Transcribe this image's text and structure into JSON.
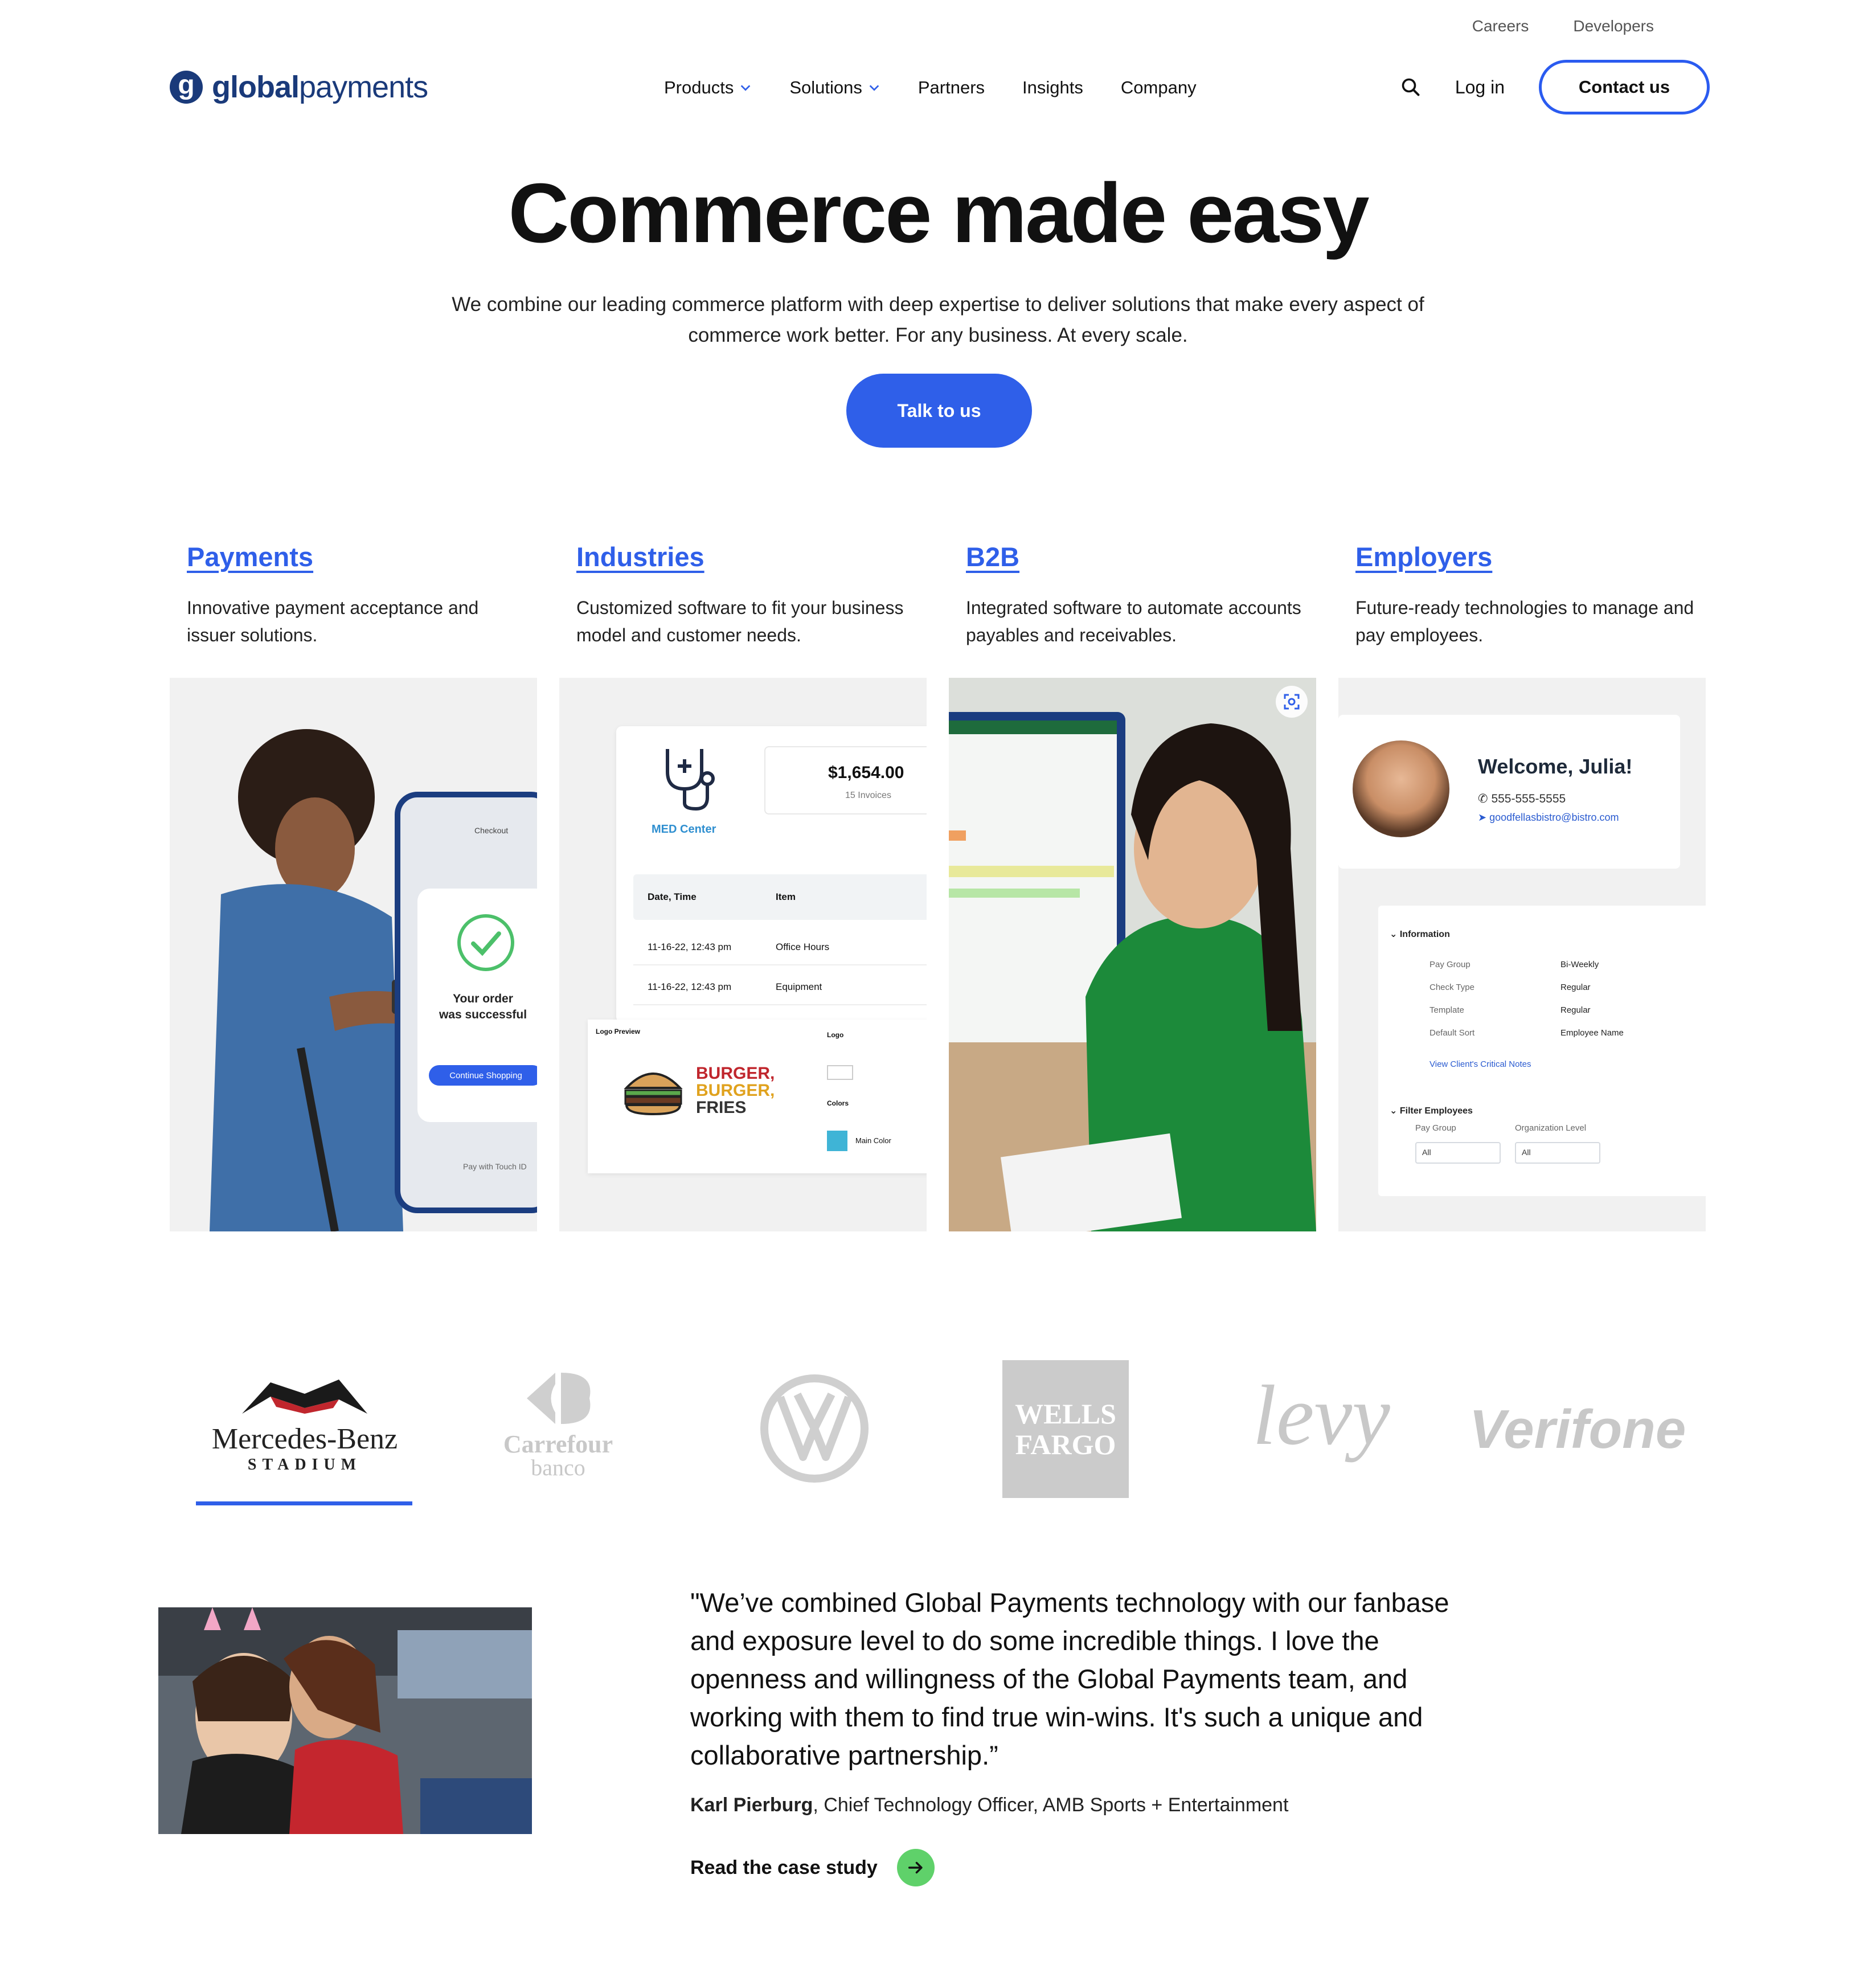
{
  "utility_nav": {
    "careers": "Careers",
    "developers": "Developers"
  },
  "brand": {
    "logo_bold": "global",
    "logo_light": "payments",
    "mark": "g"
  },
  "nav": {
    "items": [
      {
        "label": "Products",
        "has_dropdown": true
      },
      {
        "label": "Solutions",
        "has_dropdown": true
      },
      {
        "label": "Partners",
        "has_dropdown": false
      },
      {
        "label": "Insights",
        "has_dropdown": false
      },
      {
        "label": "Company",
        "has_dropdown": false
      }
    ],
    "login": "Log in",
    "contact": "Contact us"
  },
  "hero": {
    "title": "Commerce made easy",
    "subtitle": "We combine our leading commerce platform with deep expertise to deliver solutions that make every aspect of commerce work better. For any business. At every scale.",
    "cta": "Talk to us"
  },
  "categories": [
    {
      "title": "Payments",
      "desc": "Innovative payment acceptance and issuer solutions."
    },
    {
      "title": "Industries",
      "desc": "Customized software to fit your business model and customer needs."
    },
    {
      "title": "B2B",
      "desc": "Integrated software to automate accounts payables and receivables."
    },
    {
      "title": "Employers",
      "desc": "Future-ready technologies to manage and pay employees."
    }
  ],
  "payments_panel": {
    "order_msg_1": "Your order",
    "order_msg_2": "was successful",
    "continue": "Continue Shopping",
    "checkout": "Checkout",
    "touch_id": "Pay with Touch ID"
  },
  "industries_panel": {
    "amount": "$1,654.00",
    "invoices": "15 Invoices",
    "med_label": "MED Center",
    "col_date": "Date, Time",
    "col_item": "Item",
    "rows": [
      {
        "date": "11-16-22, 12:43 pm",
        "item": "Office Hours"
      },
      {
        "date": "11-16-22, 12:43 pm",
        "item": "Equipment"
      }
    ],
    "logo_preview": "Logo Preview",
    "logo": "Logo",
    "colors": "Colors",
    "main_color": "Main Color",
    "burger_lines": [
      "BURGER,",
      "BURGER,",
      "FRIES"
    ]
  },
  "employers_panel": {
    "welcome": "Welcome, Julia!",
    "phone": "555-555-5555",
    "email": "goodfellasbistro@bistro.com",
    "info_heading": "Information",
    "fields": [
      {
        "key": "Pay Group",
        "value": "Bi-Weekly"
      },
      {
        "key": "Check Type",
        "value": "Regular"
      },
      {
        "key": "Template",
        "value": "Regular"
      },
      {
        "key": "Default Sort",
        "value": "Employee Name"
      }
    ],
    "notes_link": "View Client's Critical Notes",
    "filter_heading": "Filter Employees",
    "filter_pay_group": "Pay Group",
    "filter_org_level": "Organization Level",
    "select_all": "All"
  },
  "logos": {
    "mercedes_name": "Mercedes-Benz",
    "mercedes_sub": "STADIUM",
    "carrefour": "Carrefour",
    "carrefour_sub": "banco",
    "wells_1": "WELLS",
    "wells_2": "FARGO",
    "levy": "levy",
    "verifone": "Verifone"
  },
  "testimonial": {
    "quote": "\"We’ve combined Global Payments technology with our fanbase and exposure level to do some incredible things. I love the openness and willingness of the Global Payments team, and working with them to find true win-wins. It's such a unique and collaborative partnership.”",
    "name": "Karl Pierburg",
    "role": ", Chief Technology Officer, AMB Sports + Entertainment",
    "cta": "Read the case study"
  },
  "colors": {
    "accent": "#2f5fe9",
    "brand_navy": "#1a3a7a",
    "cta_green": "#5fd16a"
  }
}
